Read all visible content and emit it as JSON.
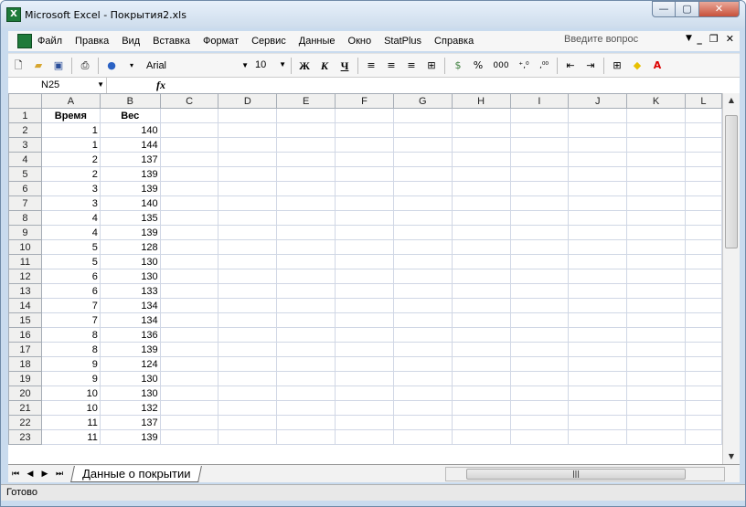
{
  "window": {
    "title": "Microsoft Excel - Покрытия2.xls",
    "minimize_label": "—",
    "maximize_label": "▢",
    "close_label": "✕"
  },
  "menu": {
    "items": [
      "Файл",
      "Правка",
      "Вид",
      "Вставка",
      "Формат",
      "Сервис",
      "Данные",
      "Окно",
      "StatPlus",
      "Справка"
    ],
    "help_placeholder": "Введите вопрос",
    "mdi_min": "_",
    "mdi_restore": "❐",
    "mdi_close": "✕"
  },
  "toolbar": {
    "font_name": "Arial",
    "font_size": "10",
    "bold_label": "Ж",
    "italic_label": "К",
    "underline_label": "Ч",
    "percent_label": "%",
    "thousands_label": "000"
  },
  "formula_bar": {
    "name_box": "N25",
    "fx_label": "fx",
    "formula": ""
  },
  "sheet": {
    "columns": [
      "A",
      "B",
      "C",
      "D",
      "E",
      "F",
      "G",
      "H",
      "I",
      "J",
      "K",
      "L"
    ],
    "header_row": [
      "Время",
      "Вес"
    ],
    "rows": [
      [
        "1",
        "140"
      ],
      [
        "1",
        "144"
      ],
      [
        "2",
        "137"
      ],
      [
        "2",
        "139"
      ],
      [
        "3",
        "139"
      ],
      [
        "3",
        "140"
      ],
      [
        "4",
        "135"
      ],
      [
        "4",
        "139"
      ],
      [
        "5",
        "128"
      ],
      [
        "5",
        "130"
      ],
      [
        "6",
        "130"
      ],
      [
        "6",
        "133"
      ],
      [
        "7",
        "134"
      ],
      [
        "7",
        "134"
      ],
      [
        "8",
        "136"
      ],
      [
        "8",
        "139"
      ],
      [
        "9",
        "124"
      ],
      [
        "9",
        "130"
      ],
      [
        "10",
        "130"
      ],
      [
        "10",
        "132"
      ],
      [
        "11",
        "137"
      ],
      [
        "11",
        "139"
      ]
    ]
  },
  "sheet_tabs": {
    "active": "Данные о покрытии"
  },
  "status": {
    "text": "Готово"
  }
}
